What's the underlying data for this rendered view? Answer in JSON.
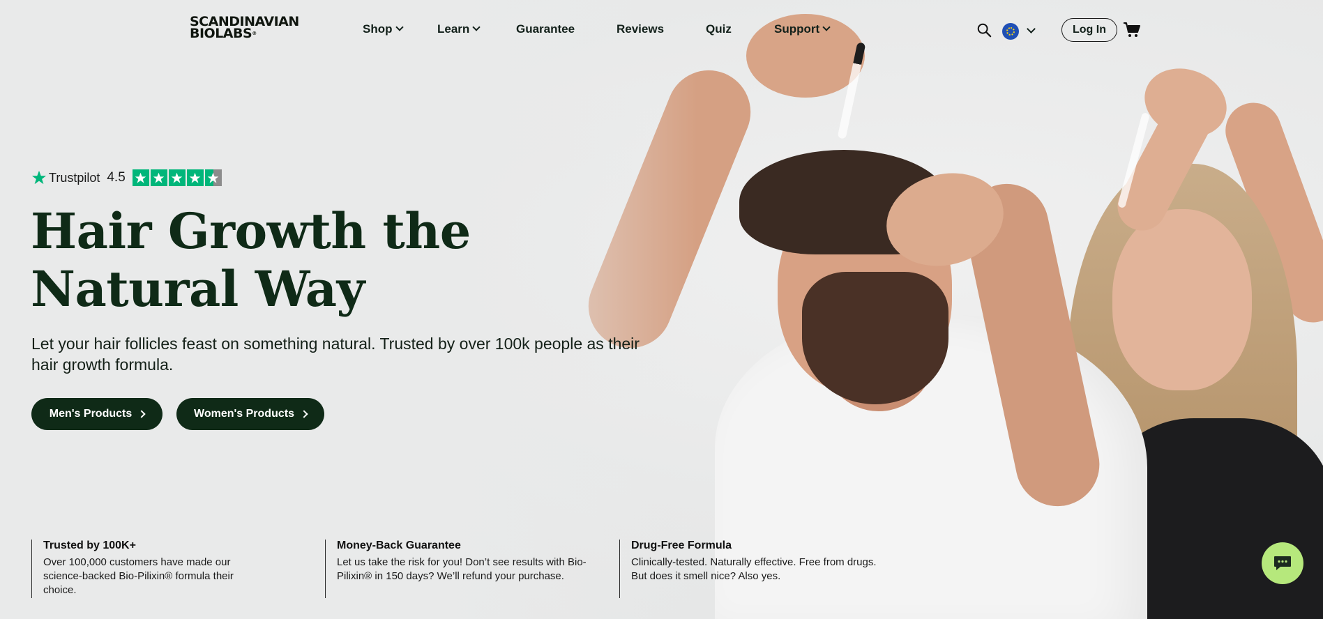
{
  "brand": {
    "logo_line1": "SCANDINAVIAN",
    "logo_line2": "BIOLABS",
    "logo_mark": "®"
  },
  "nav": {
    "items": [
      {
        "label": "Shop",
        "has_dropdown": true
      },
      {
        "label": "Learn",
        "has_dropdown": true
      },
      {
        "label": "Guarantee",
        "has_dropdown": false
      },
      {
        "label": "Reviews",
        "has_dropdown": false
      },
      {
        "label": "Quiz",
        "has_dropdown": false
      },
      {
        "label": "Support",
        "has_dropdown": true
      }
    ],
    "search_icon": "search-icon",
    "region_icon": "eu-flag-icon",
    "login_label": "Log In",
    "cart_icon": "cart-icon"
  },
  "hero": {
    "trustpilot": {
      "name": "Trustpilot",
      "score": "4.5",
      "stars": 4.5
    },
    "title": "Hair Growth the Natural Way",
    "subtitle": "Let your hair follicles feast on something natural. Trusted by over 100k people as their hair growth formula.",
    "buttons": {
      "men": "Men's Products",
      "women": "Women's Products"
    }
  },
  "features": [
    {
      "title": "Trusted by 100K+",
      "text": "Over 100,000 customers have made our science-backed Bio-Pilixin® formula their choice."
    },
    {
      "title": "Money-Back Guarantee",
      "text": "Let us take the risk for you! Don’t see results with Bio-Pilixin® in 150 days? We’ll refund your purchase."
    },
    {
      "title": "Drug-Free Formula",
      "text": "Clinically-tested. Naturally effective. Free from drugs. But does it smell nice? Also yes."
    }
  ],
  "colors": {
    "accent": "#0f2a17",
    "topline": "#ef8a4e",
    "trustpilot_green": "#00b67a",
    "chat_bubble": "#b6e87c"
  },
  "chat": {
    "icon": "chat-bubble-icon"
  }
}
